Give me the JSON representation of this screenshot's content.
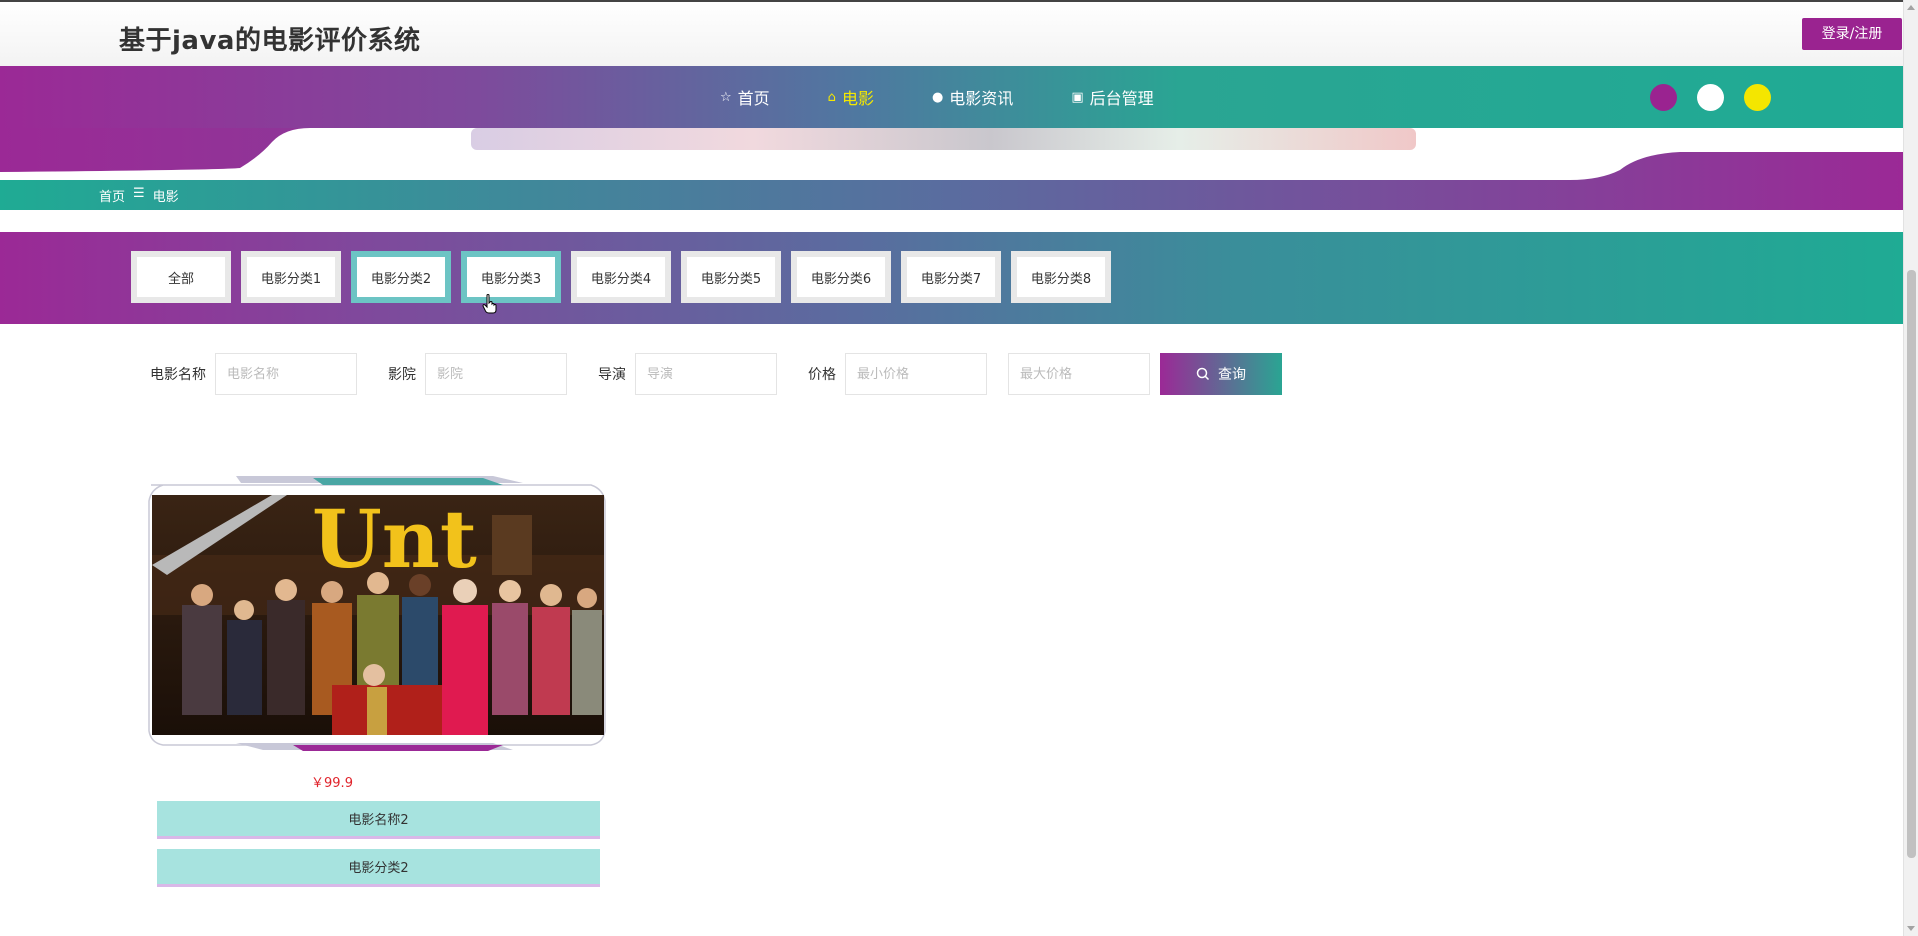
{
  "header": {
    "site_title": "基于java的电影评价系统",
    "login_label": "登录/注册"
  },
  "nav": {
    "items": [
      {
        "label": "首页",
        "icon": "star-icon",
        "glyph": "☆"
      },
      {
        "label": "电影",
        "icon": "bag-icon",
        "glyph": "⌂"
      },
      {
        "label": "电影资讯",
        "icon": "info-icon",
        "glyph": "●"
      },
      {
        "label": "后台管理",
        "icon": "admin-icon",
        "glyph": "▣"
      }
    ],
    "active_index": 1,
    "theme_colors": [
      "#9a2390",
      "#ffffff",
      "#f4e600"
    ]
  },
  "breadcrumb": {
    "home": "首页",
    "separator": "☰",
    "current": "电影"
  },
  "categories": {
    "items": [
      "全部",
      "电影分类1",
      "电影分类2",
      "电影分类3",
      "电影分类4",
      "电影分类5",
      "电影分类6",
      "电影分类7",
      "电影分类8"
    ],
    "highlighted": [
      2,
      3
    ]
  },
  "search": {
    "name_label": "电影名称",
    "name_placeholder": "电影名称",
    "cinema_label": "影院",
    "cinema_placeholder": "影院",
    "director_label": "导演",
    "director_placeholder": "导演",
    "price_label": "价格",
    "min_price_placeholder": "最小价格",
    "max_price_placeholder": "最大价格",
    "button_label": "查询"
  },
  "movies": [
    {
      "price": "￥99.9",
      "name": "电影名称2",
      "category": "电影分类2",
      "poster_title": "Unt"
    }
  ],
  "colors": {
    "purple": "#9b2996",
    "teal": "#1fab94",
    "price_red": "#e0232b",
    "card_info_bg": "#a7e3df",
    "active_nav": "#f5e900"
  }
}
